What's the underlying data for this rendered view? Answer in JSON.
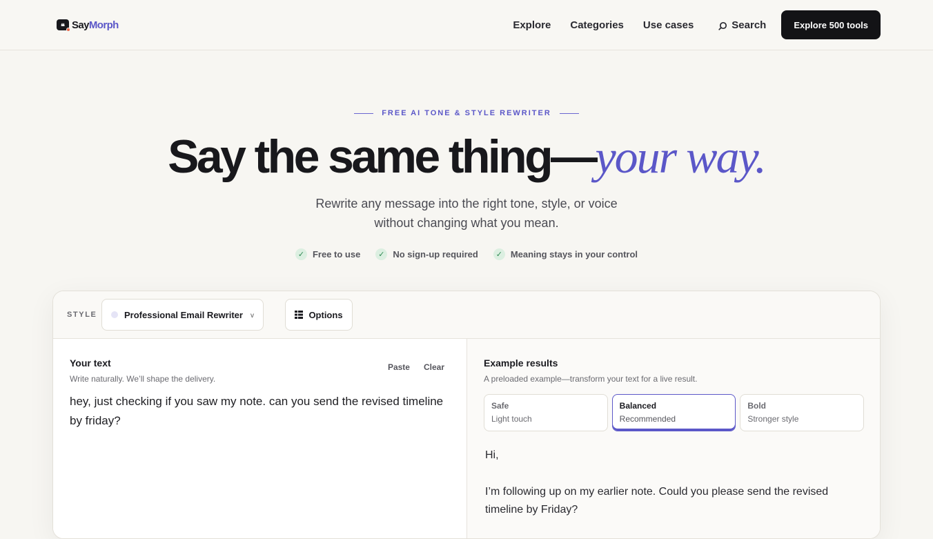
{
  "nav": {
    "logo_a": "Say",
    "logo_b": "Morph",
    "links": [
      "Explore",
      "Categories",
      "Use cases"
    ],
    "search_label": "Search",
    "cta_label": "Explore 500 tools"
  },
  "hero": {
    "eyebrow": "FREE AI TONE & STYLE REWRITER",
    "headline_main": "Say the same thing—",
    "headline_accent": "your way.",
    "subhead_line1": "Rewrite any message into the right tone, style, or voice",
    "subhead_line2": "without changing what you mean.",
    "badges": [
      "Free to use",
      "No sign-up required",
      "Meaning stays in your control"
    ]
  },
  "toolbar": {
    "style_label": "STYLE",
    "style_value": "Professional Email Rewriter",
    "options_label": "Options"
  },
  "input_pane": {
    "title": "Your text",
    "subtitle": "Write naturally. We’ll shape the delivery.",
    "paste_label": "Paste",
    "clear_label": "Clear",
    "text": "hey, just checking if you saw my note. can you send the revised timeline by friday?"
  },
  "output_pane": {
    "title": "Example results",
    "subtitle": "A preloaded example—transform your text for a live result.",
    "variants": [
      {
        "name": "Safe",
        "desc": "Light touch"
      },
      {
        "name": "Balanced",
        "desc": "Recommended"
      },
      {
        "name": "Bold",
        "desc": "Stronger style"
      }
    ],
    "result_line1": "Hi,",
    "result_line2": "I’m following up on my earlier note. Could you please send the revised timeline by Friday?"
  },
  "colors": {
    "accent": "#5b57c8",
    "cta_bg": "#131316",
    "page_bg": "#f7f6f2"
  }
}
